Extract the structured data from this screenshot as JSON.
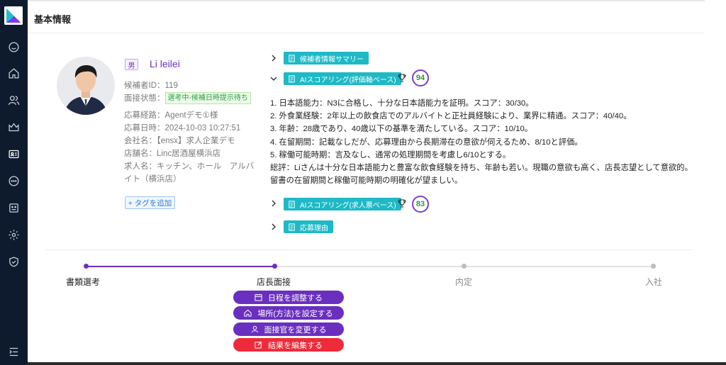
{
  "page": {
    "section_title": "基本情報"
  },
  "sidebar": {
    "icons": [
      "smile-icon",
      "home-icon",
      "users-icon",
      "crown-icon",
      "id-card-icon",
      "chat-icon",
      "robot-icon",
      "gear-icon",
      "shield-icon",
      "menu-collapse-icon"
    ]
  },
  "candidate": {
    "gender": "男",
    "name": "Li leilei",
    "id_line": "候補者ID：119",
    "status_label": "面接状態：",
    "status_value": "選考中-候補日時提示待ち",
    "route": "応募経路：Agentデモ①様",
    "applied_at": "応募日時：2024-10-03 10:27:51",
    "company": "会社名：【ensx】求人企業デモ",
    "store": "店舗名：Linc居酒屋横浜店",
    "job_line1": "求人名：キッチン、ホール　アルバ",
    "job_line2": "イト（横浜店）",
    "add_tag": "+ タグを追加"
  },
  "sections": {
    "summary_label": "候補者情報サマリー",
    "ai_score_eval_label": "AIスコアリング(評価軸ベース)",
    "ai_score_eval_value": "94",
    "ai_score_job_label": "AIスコアリング(求人票ベース)",
    "ai_score_job_value": "83",
    "reason_label": "応募理由"
  },
  "evaluation": [
    "1. 日本語能力：N3に合格し、十分な日本語能力を証明。スコア：30/30。",
    "2. 外食業経験：2年以上の飲食店でのアルバイトと正社員経験により、業界に精通。スコア：40/40。",
    "3. 年齢：28歳であり、40歳以下の基準を満たしている。スコア：10/10。",
    "4. 在留期間：記載なしだが、応募理由から長期滞在の意欲が伺えるため、8/10と評価。",
    "5. 稼働可能時期：言及なし、通常の処理期間を考慮し6/10とする。",
    "総評：Liさんは十分な日本語能力と豊富な飲食経験を持ち、年齢も若い。現職の意欲も高く、店長志望として意欲的。留書の在留期間と稼働可能時期の明確化が望ましい。"
  ],
  "progress": {
    "steps": [
      "書類選考",
      "店長面接",
      "内定",
      "入社"
    ],
    "current_step_index": 1
  },
  "actions": {
    "schedule": "日程を調整する",
    "place": "場所(方法)を設定する",
    "interviewer": "面接官を変更する",
    "result": "結果を編集する"
  },
  "colors": {
    "sidebar_bg": "#0e1b2e",
    "accent_purple": "#6a2fbf",
    "teal_tag": "#1fb9c6",
    "danger_red": "#ee2b3b",
    "score_green": "#2b9a3a"
  }
}
